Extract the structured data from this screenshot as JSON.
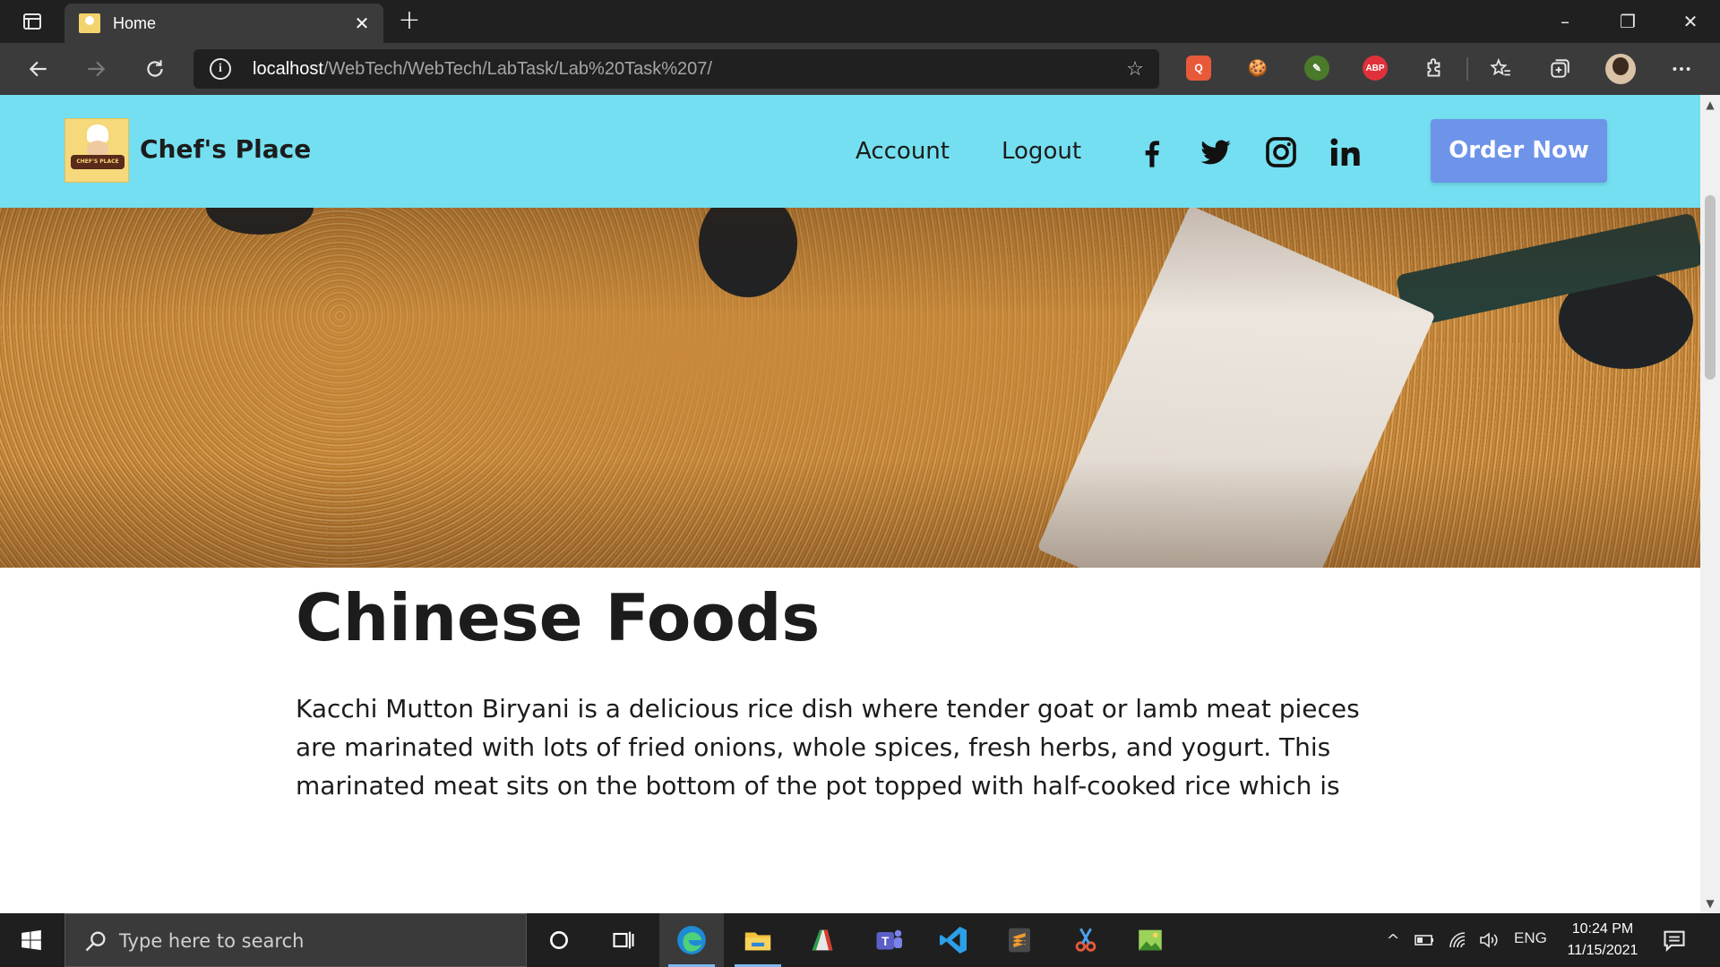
{
  "browser": {
    "tab_title": "Home",
    "tab_close": "✕",
    "new_tab": "+",
    "url_host": "localhost",
    "url_path": "/WebTech/WebTech/LabTask/Lab%20Task%207/",
    "window_controls": [
      "–",
      "❐",
      "✕"
    ],
    "extensions": [
      {
        "name": "extension-grammar-icon",
        "label": "Q",
        "color": "#e8593a"
      },
      {
        "name": "extension-cookie-icon",
        "label": "🍪",
        "color": "#3b3b3b"
      },
      {
        "name": "extension-leaf-icon",
        "label": "✎",
        "color": "#4a7a2a"
      },
      {
        "name": "extension-adblock-icon",
        "label": "ABP",
        "color": "#e0313a"
      }
    ]
  },
  "site": {
    "brand": "Chef's Place",
    "logo_text": "CHEF'S PLACE",
    "nav": [
      "Account",
      "Logout"
    ],
    "social": [
      "facebook",
      "twitter",
      "instagram",
      "linkedin"
    ],
    "order_button": "Order Now"
  },
  "content": {
    "title": "Chinese Foods",
    "paragraph": "Kacchi Mutton Biryani is a delicious rice dish where tender goat or lamb meat pieces are marinated with lots of fried onions, whole spices, fresh herbs, and yogurt. This marinated meat sits on the bottom of the pot topped with half-cooked rice which is drizzled with saffron-infused water and more"
  },
  "taskbar": {
    "search_placeholder": "Type here to search",
    "language": "ENG",
    "time": "10:24 PM",
    "date": "11/15/2021",
    "colors": {
      "accent": "#7fb8f0",
      "header_bg": "#74dff0",
      "order_button": "#6e94ea"
    }
  }
}
